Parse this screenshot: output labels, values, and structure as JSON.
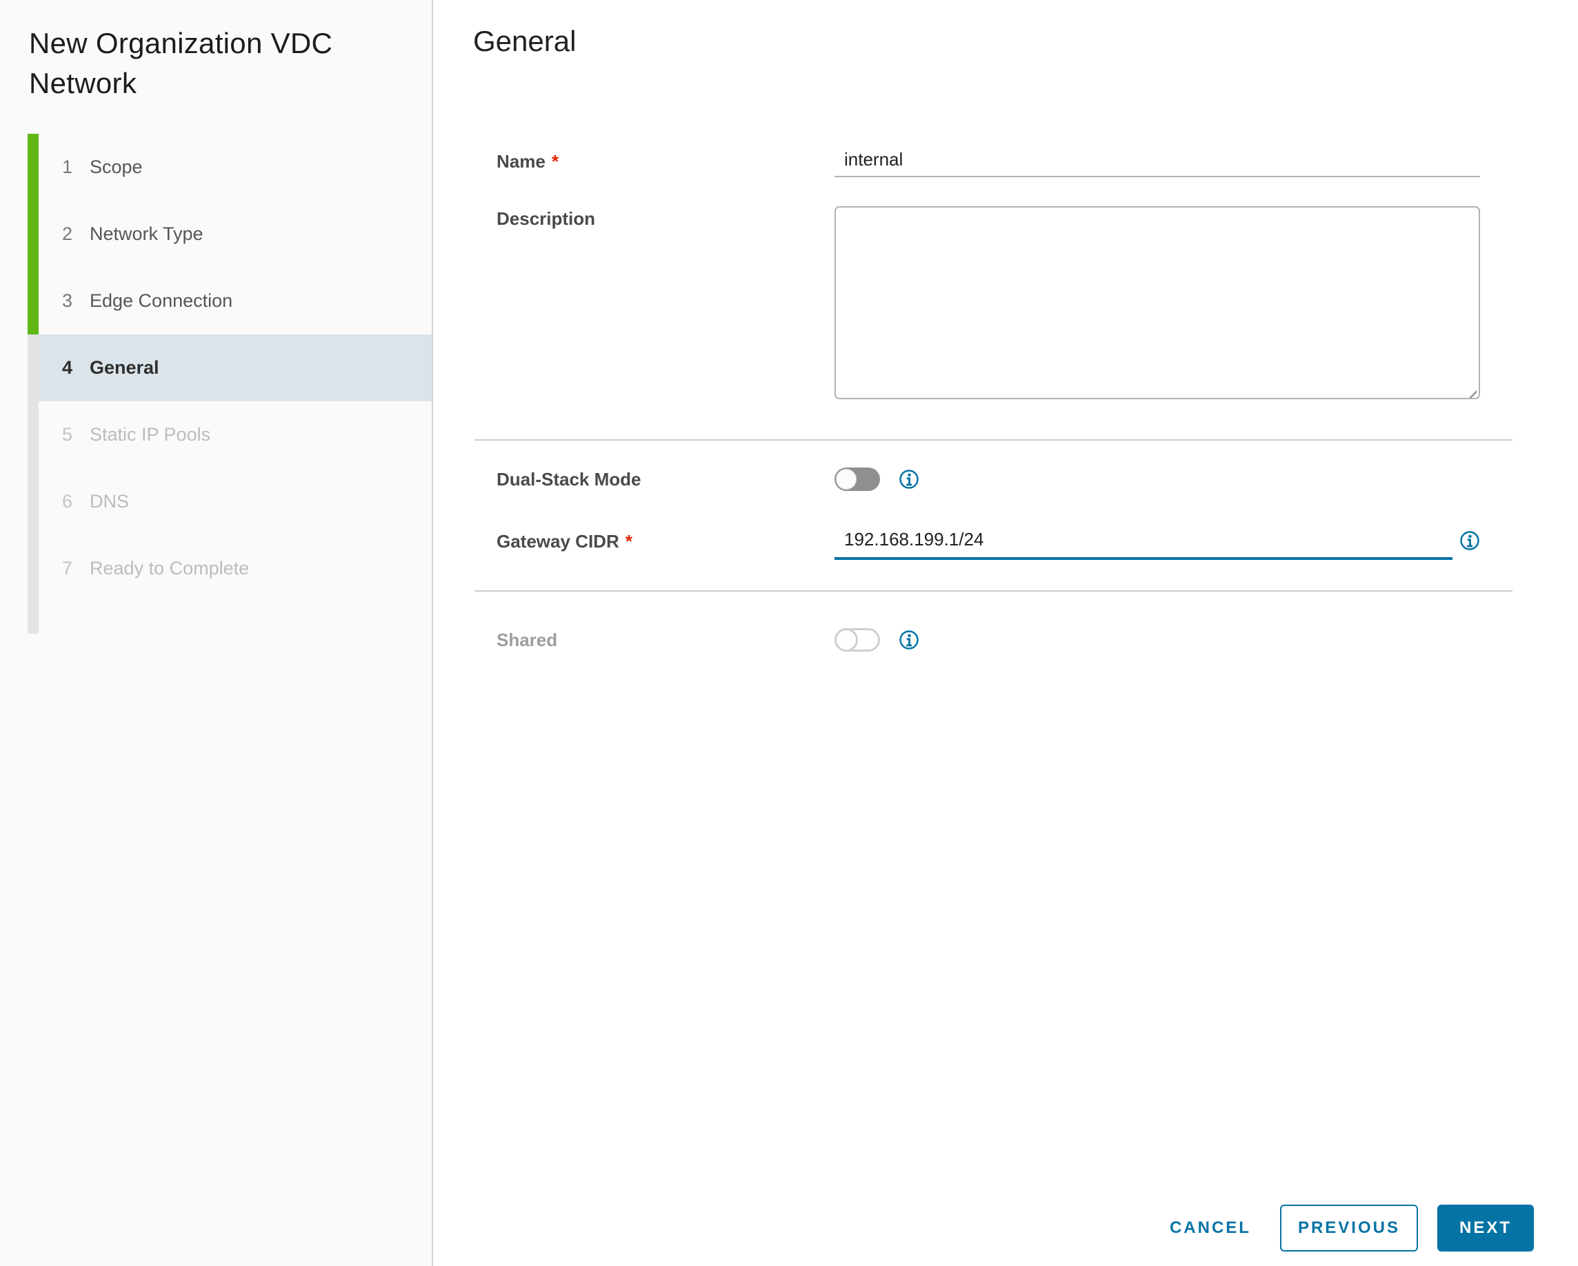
{
  "wizard": {
    "title": "New Organization VDC Network",
    "steps": [
      {
        "num": "1",
        "label": "Scope",
        "state": "completed"
      },
      {
        "num": "2",
        "label": "Network Type",
        "state": "completed"
      },
      {
        "num": "3",
        "label": "Edge Connection",
        "state": "completed"
      },
      {
        "num": "4",
        "label": "General",
        "state": "current"
      },
      {
        "num": "5",
        "label": "Static IP Pools",
        "state": "upcoming"
      },
      {
        "num": "6",
        "label": "DNS",
        "state": "upcoming"
      },
      {
        "num": "7",
        "label": "Ready to Complete",
        "state": "upcoming"
      }
    ]
  },
  "page": {
    "heading": "General"
  },
  "form": {
    "name": {
      "label": "Name",
      "required": "*",
      "value": "internal"
    },
    "description": {
      "label": "Description",
      "value": ""
    },
    "dual_stack": {
      "label": "Dual-Stack Mode",
      "state": "off"
    },
    "gateway_cidr": {
      "label": "Gateway CIDR",
      "required": "*",
      "value": "192.168.199.1/24"
    },
    "shared": {
      "label": "Shared",
      "state": "off-disabled"
    }
  },
  "footer": {
    "cancel": "CANCEL",
    "previous": "PREVIOUS",
    "next": "NEXT"
  },
  "colors": {
    "accent_blue": "#0673a5",
    "progress_green": "#61b715",
    "required_red": "#e12200",
    "current_step_bg": "#dbe4ea",
    "sidebar_bg": "#fafafa",
    "underline_gray": "#b3b3b3"
  }
}
